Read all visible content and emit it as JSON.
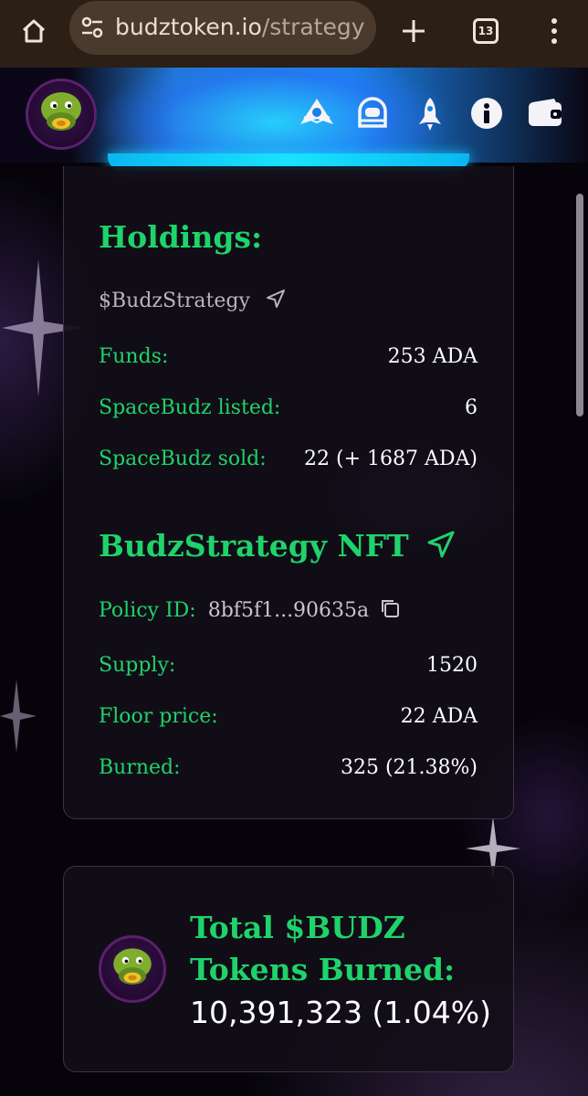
{
  "browser": {
    "url_domain": "budztoken.io",
    "url_path": "/strategy",
    "tab_count": "13"
  },
  "header": {
    "nav_icons": [
      "ship-emblem-icon",
      "helmet-icon",
      "rocket-icon",
      "info-icon",
      "wallet-icon"
    ]
  },
  "holdings": {
    "title": "Holdings:",
    "token": "$BudzStrategy",
    "rows": [
      {
        "label": "Funds:",
        "value": "253 ADA"
      },
      {
        "label": "SpaceBudz listed:",
        "value": "6"
      },
      {
        "label": "SpaceBudz sold:",
        "value": "22 (+ 1687 ADA)"
      }
    ]
  },
  "nft": {
    "title": "BudzStrategy NFT",
    "policy_label": "Policy ID:",
    "policy_value": "8bf5f1...90635a",
    "rows": [
      {
        "label": "Supply:",
        "value": "1520"
      },
      {
        "label": "Floor price:",
        "value": "22 ADA"
      },
      {
        "label": "Burned:",
        "value": "325 (21.38%)"
      }
    ]
  },
  "burned": {
    "title_line1": "Total $BUDZ",
    "title_line2": "Tokens Burned:",
    "value": "10,391,323 (1.04%)"
  },
  "colors": {
    "accent_green": "#1fd36b",
    "background": "#06040a",
    "header_glow": "#19e3ff"
  }
}
